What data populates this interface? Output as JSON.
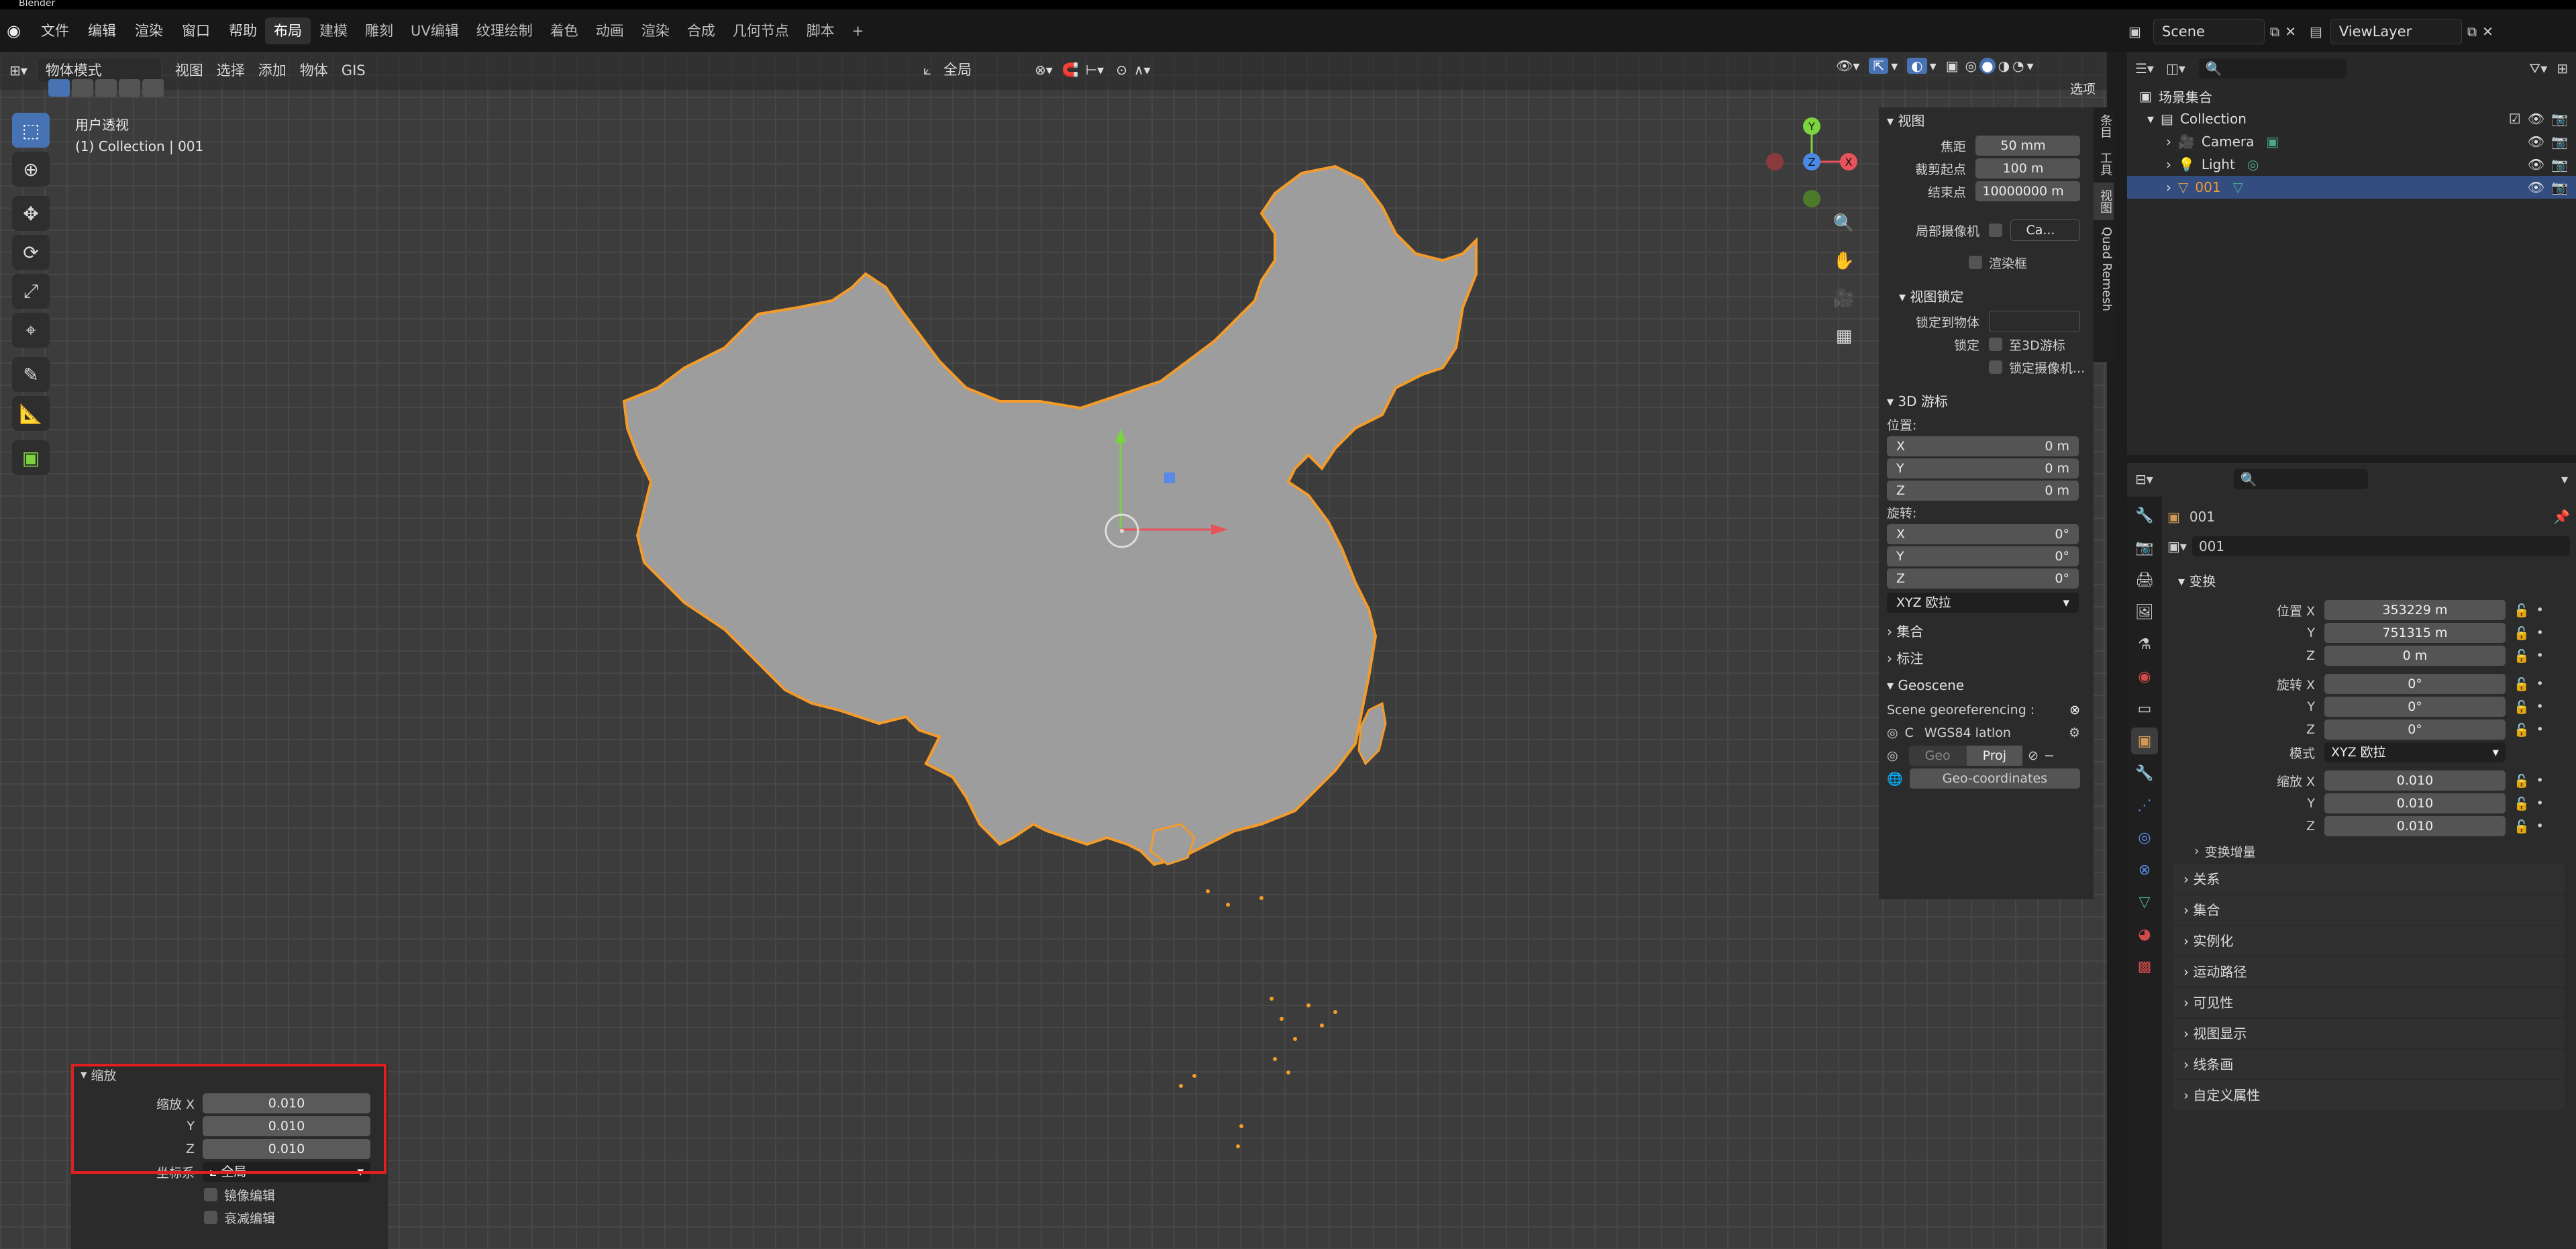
{
  "app": {
    "title": "Blender"
  },
  "menu": {
    "items": [
      "文件",
      "编辑",
      "渲染",
      "窗口",
      "帮助"
    ]
  },
  "workspaces": {
    "tabs": [
      "布局",
      "建模",
      "雕刻",
      "UV编辑",
      "纹理绘制",
      "着色",
      "动画",
      "渲染",
      "合成",
      "几何节点",
      "脚本"
    ],
    "active": "布局",
    "add": "+"
  },
  "top_right": {
    "scene": "Scene",
    "view_layer": "ViewLayer"
  },
  "viewport_header": {
    "mode": "物体模式",
    "menus": [
      "视图",
      "选择",
      "添加",
      "物体",
      "GIS"
    ],
    "orientation": "全局",
    "options": "选项"
  },
  "viewport": {
    "view_name": "用户透视",
    "collection_info": "(1) Collection | 001",
    "gizmo": {
      "y": "Y",
      "z": "Z",
      "x": "X"
    }
  },
  "npanel": {
    "view": {
      "title": "视图",
      "focal_label": "焦距",
      "focal_value": "50 mm",
      "clip_start_label": "裁剪起点",
      "clip_start_value": "100 m",
      "clip_end_label": "结束点",
      "clip_end_value": "10000000 m",
      "local_camera_label": "局部摄像机",
      "local_camera_value": "Ca...",
      "render_region": "渲染框"
    },
    "view_lock": {
      "title": "视图锁定",
      "lock_object_label": "锁定到物体",
      "lock_label": "锁定",
      "to_3d_cursor": "至3D游标",
      "lock_camera": "锁定摄像机..."
    },
    "cursor": {
      "title": "3D 游标",
      "location_label": "位置:",
      "loc": [
        {
          "axis": "X",
          "value": "0 m"
        },
        {
          "axis": "Y",
          "value": "0 m"
        },
        {
          "axis": "Z",
          "value": "0 m"
        }
      ],
      "rotation_label": "旋转:",
      "rot": [
        {
          "axis": "X",
          "value": "0°"
        },
        {
          "axis": "Y",
          "value": "0°"
        },
        {
          "axis": "Z",
          "value": "0°"
        }
      ],
      "rotation_mode": "XYZ 欧拉"
    },
    "collapsed": [
      "集合",
      "标注"
    ],
    "geoscene": {
      "title": "Geoscene",
      "georef_label": "Scene georeferencing :",
      "crs_prefix": "C",
      "crs": "WGS84 latlon",
      "geo_tab": "Geo",
      "proj_tab": "Proj",
      "geo_coords_button": "Geo-coordinates"
    },
    "vertical_tabs": [
      "条目",
      "工具",
      "视图",
      "Quad Remesh"
    ]
  },
  "outliner": {
    "search_placeholder": "",
    "root": "场景集合",
    "collection": "Collection",
    "items": [
      {
        "name": "Camera"
      },
      {
        "name": "Light"
      },
      {
        "name": "001"
      }
    ]
  },
  "properties": {
    "object_name": "001",
    "object_field": "001",
    "transform": {
      "title": "变换",
      "location_label": "位置 X",
      "location": [
        "353229 m",
        "751315 m",
        "0 m"
      ],
      "rotation_label": "旋转 X",
      "rotation": [
        "0°",
        "0°",
        "0°"
      ],
      "mode_label": "模式",
      "mode": "XYZ 欧拉",
      "scale_label": "缩放 X",
      "scale": [
        "0.010",
        "0.010",
        "0.010"
      ],
      "delta": "变换增量",
      "axis_y": "Y",
      "axis_z": "Z"
    },
    "sections": [
      "关系",
      "集合",
      "实例化",
      "运动路径",
      "可见性",
      "视图显示",
      "线条画",
      "自定义属性"
    ]
  },
  "redo_panel": {
    "title": "缩放",
    "scale_x_label": "缩放 X",
    "y_label": "Y",
    "z_label": "Z",
    "values": [
      "0.010",
      "0.010",
      "0.010"
    ],
    "orient_label": "坐标系",
    "orient_value": "全局",
    "mirror": "镜像编辑",
    "proportional": "衰减编辑"
  },
  "colors": {
    "accent": "#4772b3",
    "selection_outline": "#f39b2b",
    "highlight_box": "#e02020"
  }
}
